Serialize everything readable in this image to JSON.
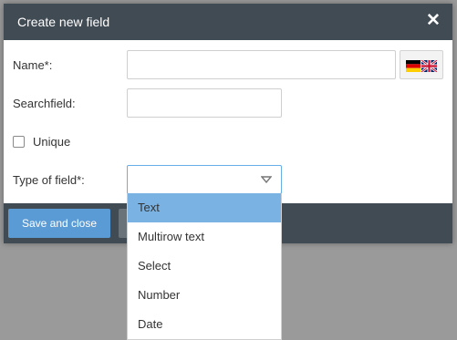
{
  "dialog": {
    "title": "Create new field",
    "close_glyph": "✕"
  },
  "form": {
    "name_label": "Name*:",
    "name_value": "",
    "name_placeholder": "",
    "language_icon": "de-en-flag-icon",
    "searchfield_label": "Searchfield:",
    "searchfield_value": "",
    "unique_label": "Unique",
    "unique_checked": false,
    "type_label": "Type of field*:",
    "type_value": ""
  },
  "dropdown": {
    "options": [
      "Text",
      "Multirow text",
      "Select",
      "Number",
      "Date"
    ],
    "highlighted": "Text"
  },
  "footer": {
    "save_label": "Save and close"
  },
  "colors": {
    "header_bg": "#414b54",
    "primary_button": "#5b9bd5",
    "highlight": "#7ab3e3",
    "overlay": "#9a9a9a"
  }
}
